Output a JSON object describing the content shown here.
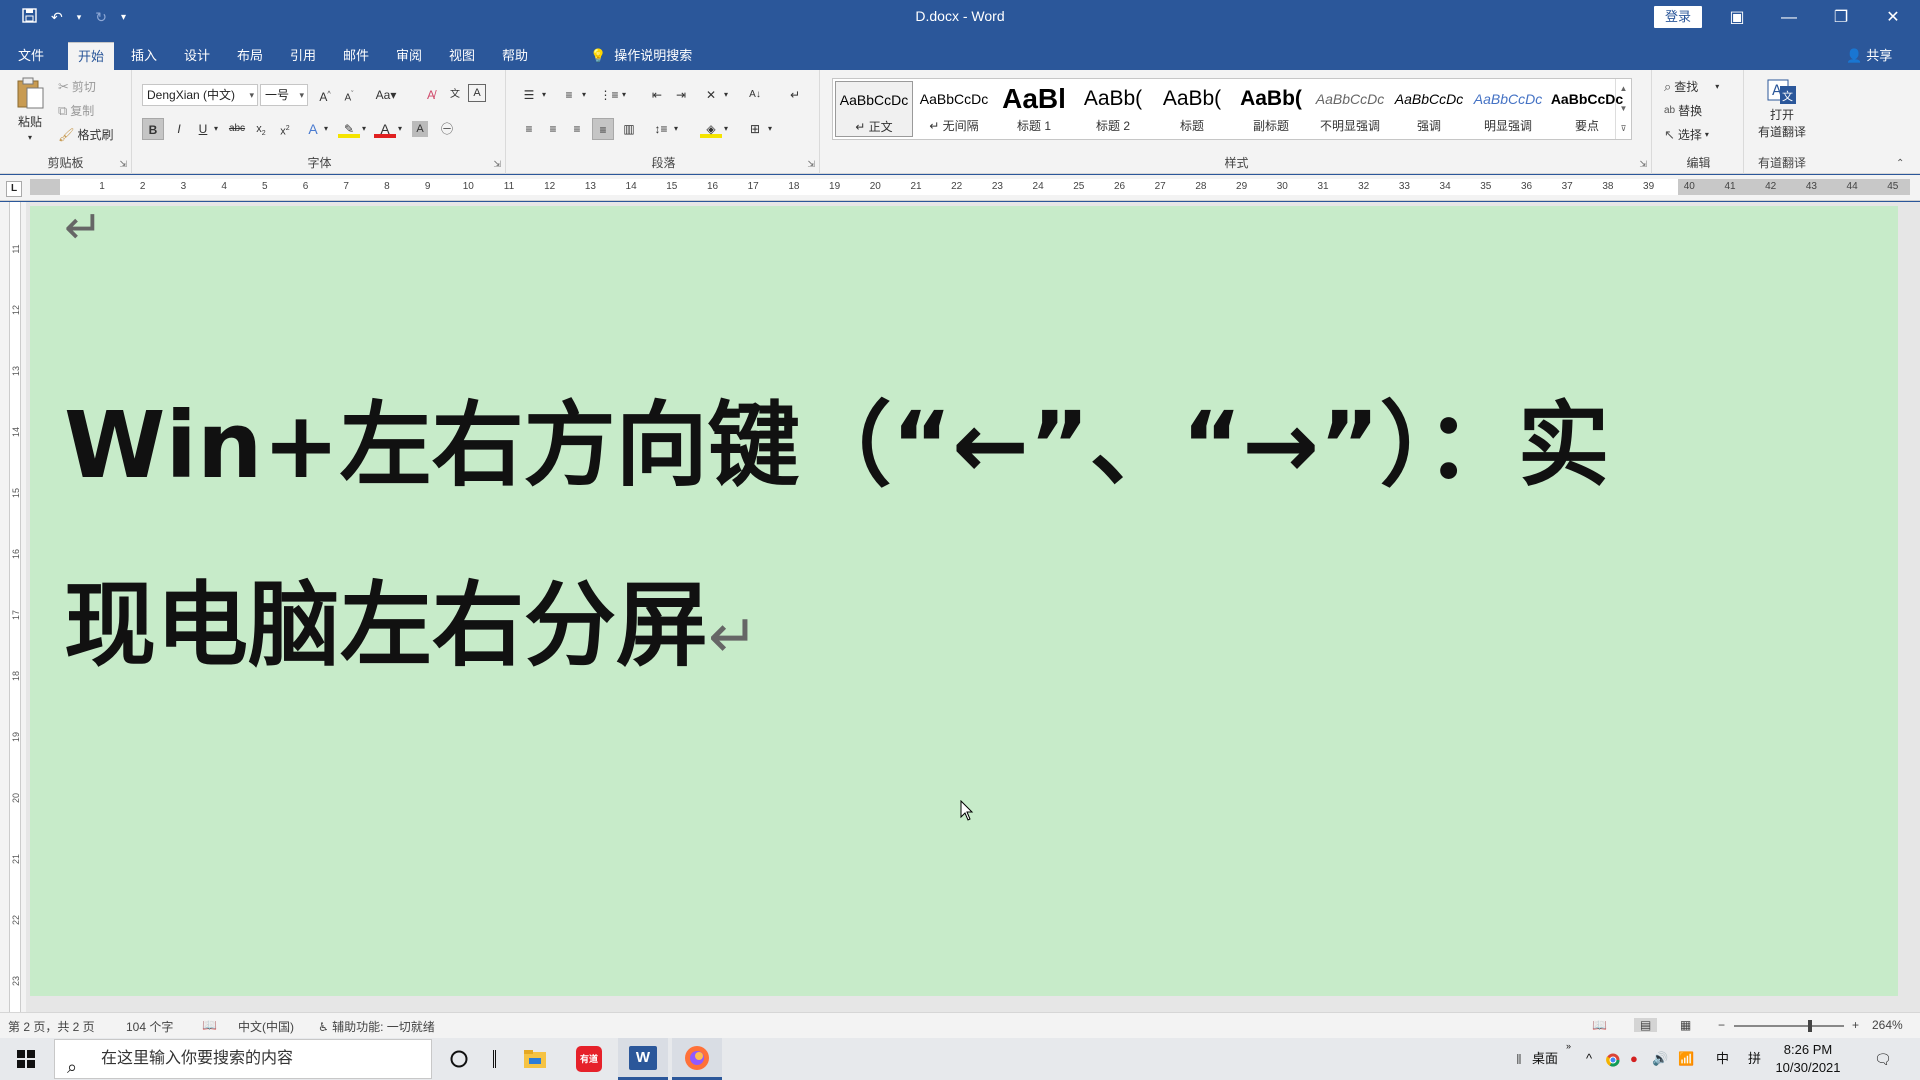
{
  "titlebar": {
    "doc_title": "D.docx  -  Word",
    "login_label": "登录",
    "qat": {
      "save_icon": "save-icon",
      "undo_icon": "undo-icon",
      "redo_icon": "redo-icon",
      "customize_icon": "customize-icon"
    }
  },
  "tabs": [
    {
      "label": "文件"
    },
    {
      "label": "开始"
    },
    {
      "label": "插入"
    },
    {
      "label": "设计"
    },
    {
      "label": "布局"
    },
    {
      "label": "引用"
    },
    {
      "label": "邮件"
    },
    {
      "label": "审阅"
    },
    {
      "label": "视图"
    },
    {
      "label": "帮助"
    }
  ],
  "active_tab": "开始",
  "tell_me": "操作说明搜索",
  "share_label": "共享",
  "ribbon": {
    "clipboard": {
      "paste": "粘贴",
      "cut": "剪切",
      "copy": "复制",
      "format_painter": "格式刷",
      "label": "剪贴板"
    },
    "font": {
      "font_name": "DengXian (中文)",
      "font_size": "一号",
      "label": "字体"
    },
    "paragraph": {
      "label": "段落"
    },
    "styles": {
      "label": "样式",
      "items": [
        {
          "sample": "AaBbCcDc",
          "name": "↵ 正文"
        },
        {
          "sample": "AaBbCcDc",
          "name": "↵ 无间隔"
        },
        {
          "sample": "AaBl",
          "name": "标题 1"
        },
        {
          "sample": "AaBb(",
          "name": "标题 2"
        },
        {
          "sample": "AaBb(",
          "name": "标题"
        },
        {
          "sample": "AaBb(",
          "name": "副标题"
        },
        {
          "sample": "AaBbCcDc",
          "name": "不明显强调"
        },
        {
          "sample": "AaBbCcDc",
          "name": "强调"
        },
        {
          "sample": "AaBbCcDc",
          "name": "明显强调"
        },
        {
          "sample": "AaBbCcDc",
          "name": "要点"
        }
      ]
    },
    "editing": {
      "find": "查找",
      "replace": "替换",
      "select": "选择",
      "label": "编辑"
    },
    "translate": {
      "line1": "打开",
      "line2": "有道翻译",
      "label": "有道翻译"
    }
  },
  "ruler": {
    "numbers": [
      "1",
      "2",
      "3",
      "4",
      "5",
      "6",
      "7",
      "8",
      "9",
      "10",
      "11",
      "12",
      "13",
      "14",
      "15",
      "16",
      "17",
      "18",
      "19",
      "20",
      "21",
      "22",
      "23",
      "24",
      "25",
      "26",
      "27",
      "28",
      "29",
      "30",
      "31",
      "32",
      "33",
      "34",
      "35",
      "36",
      "37",
      "38",
      "39",
      "40",
      "41",
      "42",
      "43",
      "44",
      "45"
    ],
    "vnumbers": [
      "11",
      "12",
      "13",
      "14",
      "15",
      "16",
      "17",
      "18",
      "19",
      "20",
      "21",
      "22",
      "23"
    ]
  },
  "document": {
    "heading": "Win+左右方向键（“←”、“→”）：实现电脑左右分屏",
    "para_mark": "↵",
    "page_color": "#c7ebc9"
  },
  "statusbar": {
    "page": "第 2 页，共 2 页",
    "words": "104 个字",
    "language": "中文(中国)",
    "accessibility": "辅助功能: 一切就绪",
    "zoom": "264%",
    "zoom_minus": "−",
    "zoom_plus": "+"
  },
  "taskbar": {
    "search_placeholder": "在这里输入你要搜索的内容",
    "desktop": "桌面",
    "ime_lang": "中",
    "ime_mode": "拼",
    "time": "8:26 PM",
    "date": "10/30/2021",
    "youdao_badge": "有道"
  },
  "colors": {
    "accent": "#2b579a",
    "ribbon_bg": "#f3f3f3",
    "page_bg": "#c7ebc9"
  }
}
